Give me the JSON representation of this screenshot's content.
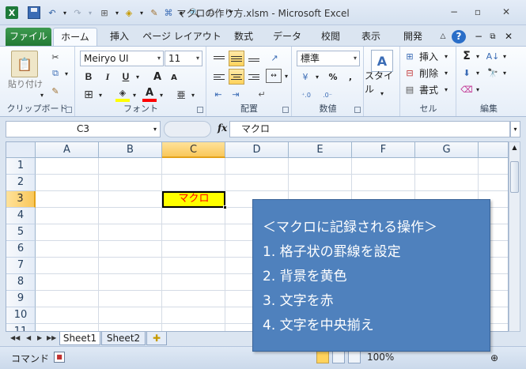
{
  "titlebar": {
    "title": "マクロの作り方.xlsm  -  Microsoft Excel",
    "excel_icon": "X",
    "minimize": "−",
    "restore": "▫",
    "close": "✕"
  },
  "ribbon_tabs": {
    "file": "ファイル",
    "tabs": [
      "ホーム",
      "挿入",
      "ページ レイアウト",
      "数式",
      "データ",
      "校閲",
      "表示",
      "開発"
    ]
  },
  "ribbon": {
    "clipboard": {
      "paste_label": "貼り付け",
      "group_label": "クリップボード"
    },
    "font": {
      "font_name": "Meiryo UI",
      "font_size": "11",
      "bold": "B",
      "italic": "I",
      "underline": "U",
      "grow": "A",
      "shrink": "A",
      "group_label": "フォント"
    },
    "alignment": {
      "group_label": "配置"
    },
    "number": {
      "format": "標準",
      "percent": "%",
      "comma": ",",
      "group_label": "数値"
    },
    "styles": {
      "label": "スタイル"
    },
    "cells": {
      "insert": "挿入",
      "delete": "削除",
      "format": "書式",
      "group_label": "セル"
    },
    "editing": {
      "sum": "Σ",
      "group_label": "編集"
    }
  },
  "formula_bar": {
    "name_box": "C3",
    "fx": "fx",
    "value": "マクロ"
  },
  "grid": {
    "columns": [
      "A",
      "B",
      "C",
      "D",
      "E",
      "F",
      "G"
    ],
    "rows": [
      "1",
      "2",
      "3",
      "4",
      "5",
      "6",
      "7",
      "8",
      "9",
      "10",
      "11"
    ],
    "active_cell": "C3",
    "cell_c3_value": "マクロ",
    "cell_c3_fill": "#ffff00",
    "cell_c3_text_color": "#ff0000"
  },
  "sheets": {
    "tabs": [
      "Sheet1",
      "Sheet2"
    ],
    "active": "Sheet1"
  },
  "statusbar": {
    "mode": "コマンド",
    "zoom": "100%"
  },
  "callout": {
    "heading": "＜マクロに記録される操作＞",
    "steps": [
      "1. 格子状の罫線を設定",
      "2. 背景を黄色",
      "3. 文字を赤",
      "4. 文字を中央揃え"
    ],
    "background": "#4f81bd"
  }
}
